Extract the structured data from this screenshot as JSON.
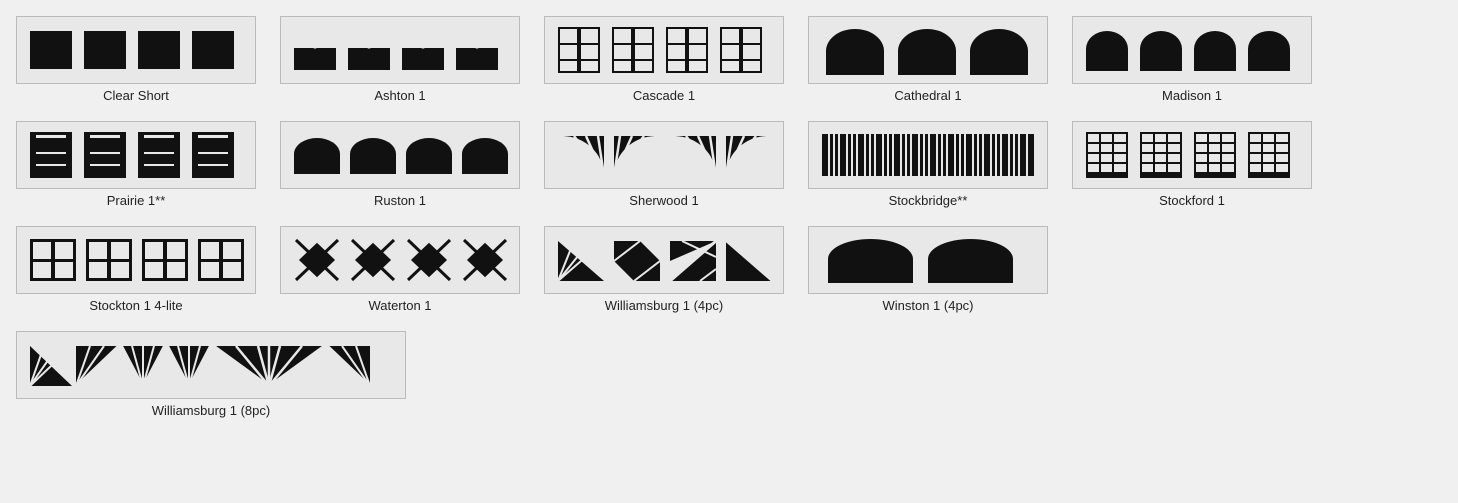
{
  "panels": [
    {
      "id": "clear-short",
      "label": "Clear Short",
      "wide": false
    },
    {
      "id": "ashton-1",
      "label": "Ashton 1",
      "wide": false
    },
    {
      "id": "cascade-1",
      "label": "Cascade 1",
      "wide": false
    },
    {
      "id": "cathedral-1",
      "label": "Cathedral 1",
      "wide": false
    },
    {
      "id": "madison-1",
      "label": "Madison 1",
      "wide": false
    },
    {
      "id": "prairie-1",
      "label": "Prairie 1**",
      "wide": false
    },
    {
      "id": "ruston-1",
      "label": "Ruston 1",
      "wide": false
    },
    {
      "id": "sherwood-1",
      "label": "Sherwood 1",
      "wide": false
    },
    {
      "id": "stockbridge",
      "label": "Stockbridge**",
      "wide": false
    },
    {
      "id": "stockford-1",
      "label": "Stockford 1",
      "wide": false
    },
    {
      "id": "stockton-1",
      "label": "Stockton 1 4-lite",
      "wide": false
    },
    {
      "id": "waterton-1",
      "label": "Waterton 1",
      "wide": false
    },
    {
      "id": "williamsburg-1-4pc",
      "label": "Williamsburg 1 (4pc)",
      "wide": false
    },
    {
      "id": "winston-1",
      "label": "Winston 1 (4pc)",
      "wide": false
    },
    {
      "id": "williamsburg-1-8pc",
      "label": "Williamsburg 1 (8pc)",
      "wide": true
    }
  ]
}
